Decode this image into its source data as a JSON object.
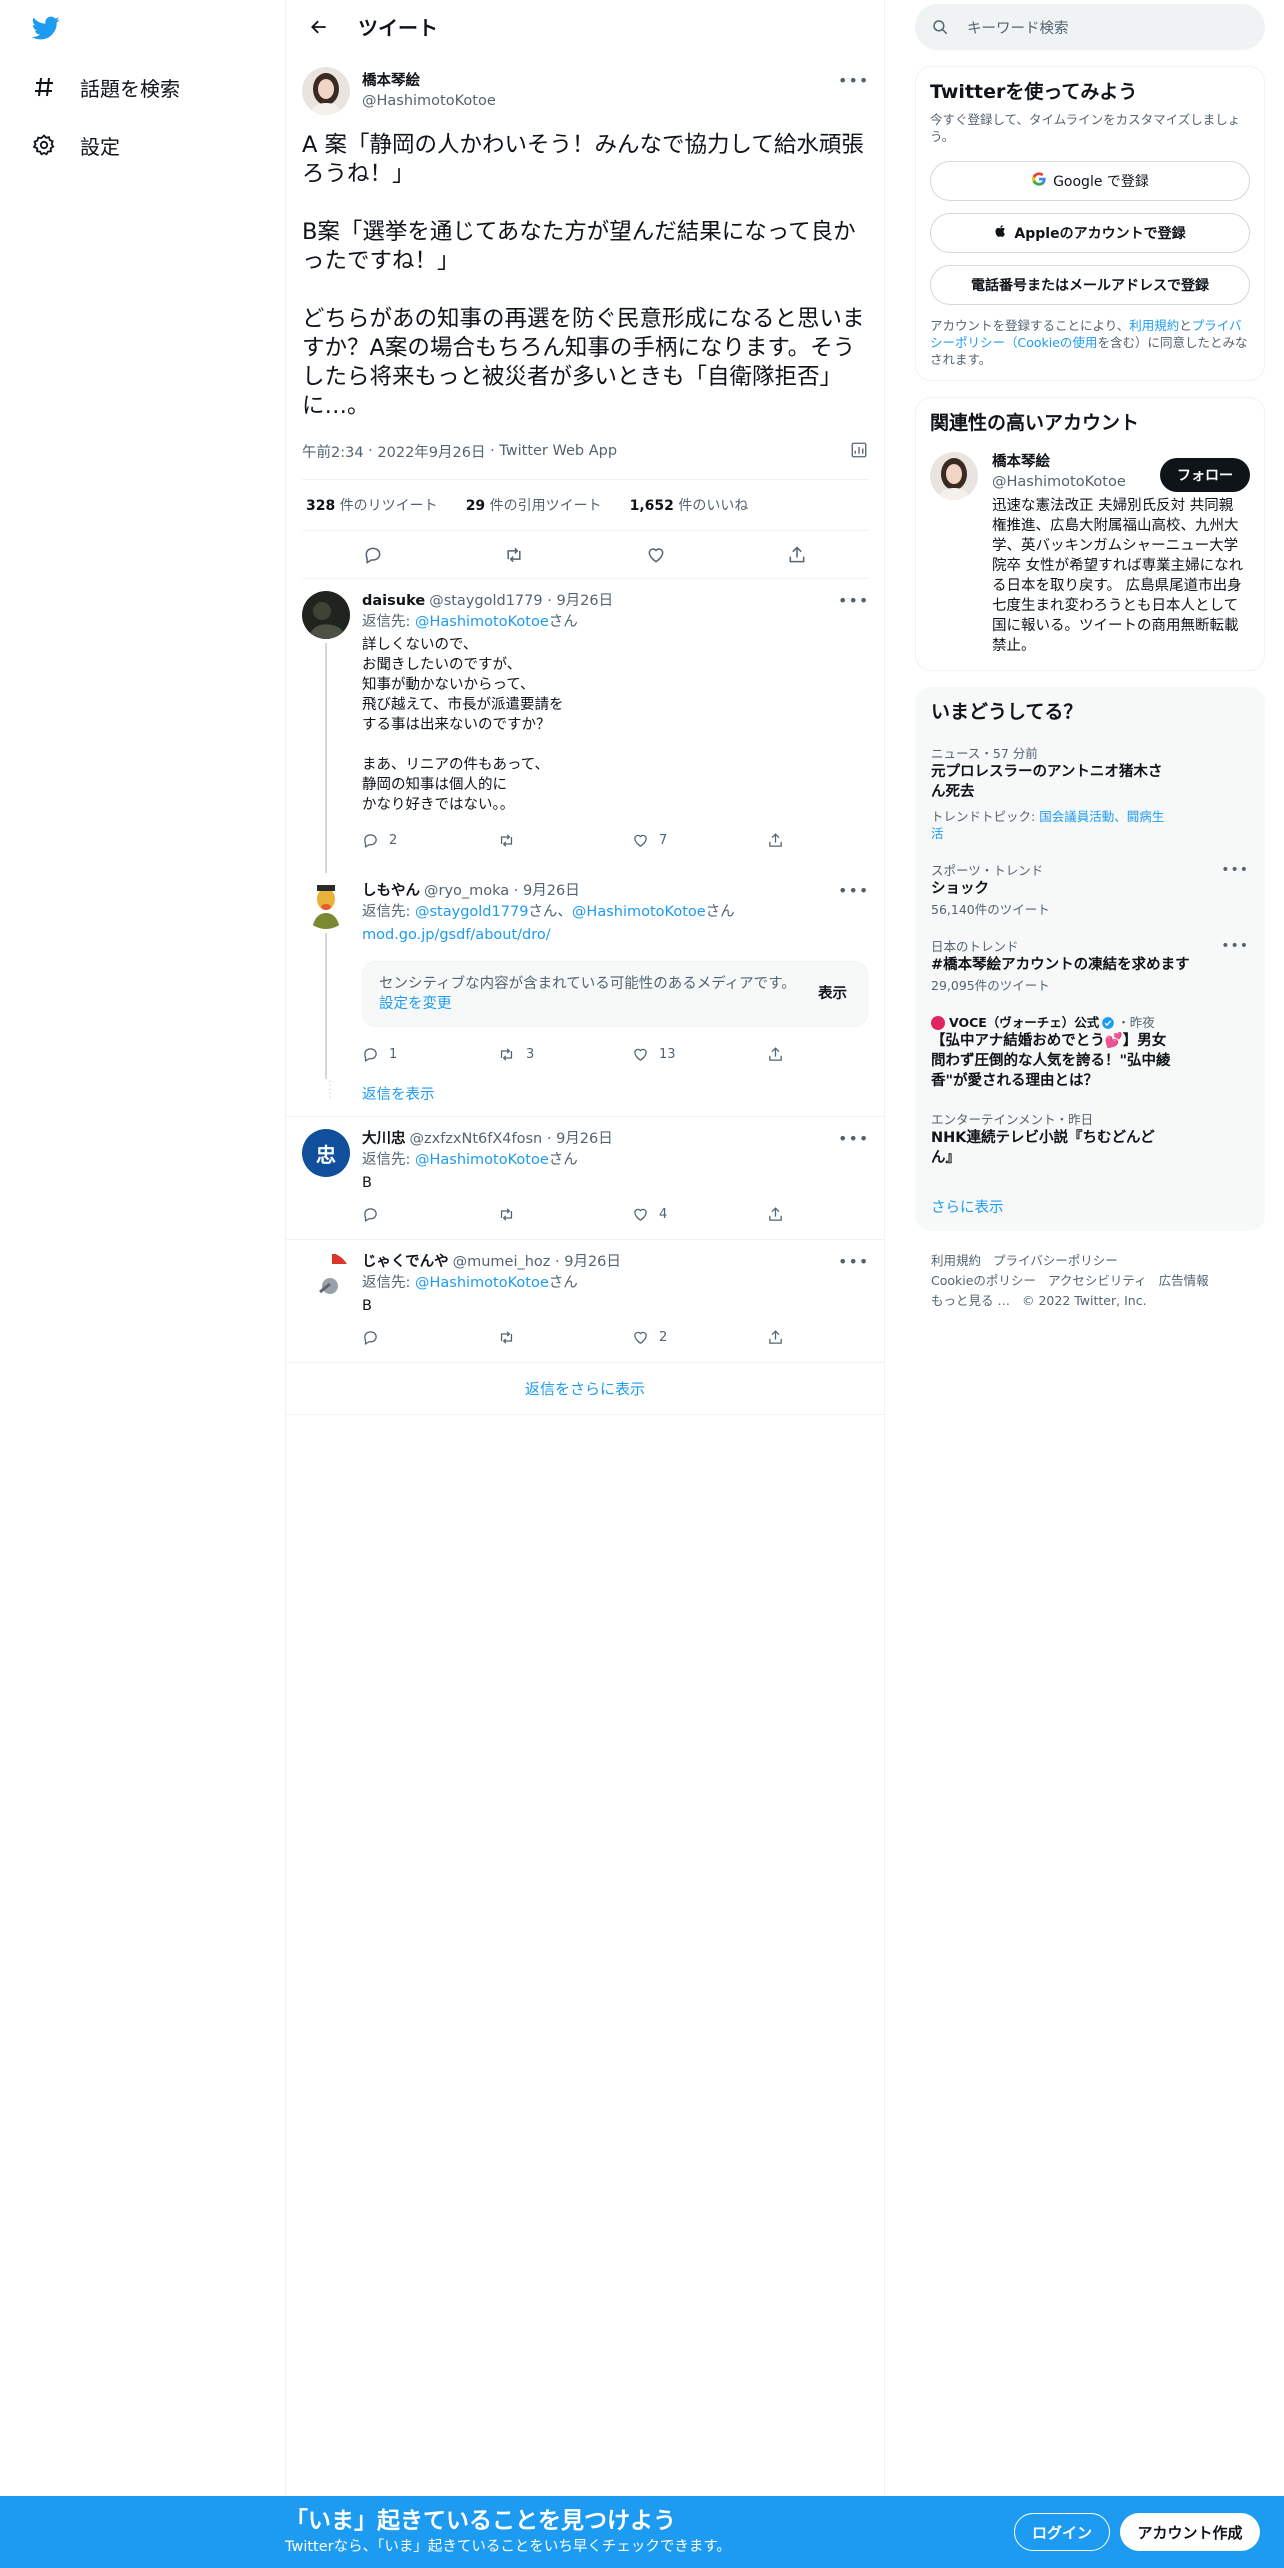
{
  "nav": {
    "explore_label": "話題を検索",
    "settings_label": "設定"
  },
  "header": {
    "title": "ツイート"
  },
  "focal": {
    "name": "橋本琴絵",
    "handle": "@HashimotoKotoe",
    "text": "A 案「静岡の人かわいそう！みんなで協力して給水頑張ろうね！」\n\nB案「選挙を通じてあなた方が望んだ結果になって良かったですね！」\n\nどちらがあの知事の再選を防ぐ民意形成になると思いますか？A案の場合もちろん知事の手柄になります。そうしたら将来もっと被災者が多いときも「自衛隊拒否」に…。",
    "time": "午前2:34",
    "date": "2022年9月26日",
    "source": "Twitter Web App",
    "retweets": "328",
    "retweets_label": "件のリツイート",
    "quotes": "29",
    "quotes_label": "件の引用ツイート",
    "likes": "1,652",
    "likes_label": "件のいいね"
  },
  "replies": [
    {
      "name": "daisuke",
      "handle": "@staygold1779",
      "date": "9月26日",
      "reply_to_prefix": "返信先: ",
      "reply_to": "@HashimotoKotoe",
      "reply_to_suffix": "さん",
      "text": "詳しくないので、\nお聞きしたいのですが、\n知事が動かないからって、\n飛び越えて、市長が派遣要請を\nする事は出来ないのですか？\n\nまあ、リニアの件もあって、\n静岡の知事は個人的に\nかなり好きではない。。",
      "replies": "2",
      "retweets": "",
      "likes": "7"
    },
    {
      "name": "しもやん",
      "handle": "@ryo_moka",
      "date": "9月26日",
      "reply_to_prefix": "返信先: ",
      "reply_to": "@staygold1779",
      "reply_to_mid": "さん、",
      "reply_to2": "@HashimotoKotoe",
      "reply_to_suffix": "さん",
      "link": "mod.go.jp/gsdf/about/dro/",
      "sensitive_text": "センシティブな内容が含まれている可能性のあるメディアです。",
      "sensitive_link": "設定を変更",
      "sensitive_show": "表示",
      "replies": "1",
      "retweets": "3",
      "likes": "13"
    },
    {
      "name": "大川忠",
      "handle": "@zxfzxNt6fX4fosn",
      "date": "9月26日",
      "reply_to_prefix": "返信先: ",
      "reply_to": "@HashimotoKotoe",
      "reply_to_suffix": "さん",
      "text": "B",
      "replies": "",
      "retweets": "",
      "likes": "4",
      "avatar_char": "忠"
    },
    {
      "name": "じゃくでんや",
      "handle": "@mumei_hoz",
      "date": "9月26日",
      "reply_to_prefix": "返信先: ",
      "reply_to": "@HashimotoKotoe",
      "reply_to_suffix": "さん",
      "text": "B",
      "replies": "",
      "retweets": "",
      "likes": "2"
    }
  ],
  "show_replies_label": "返信を表示",
  "more_replies_label": "返信をさらに表示",
  "search": {
    "placeholder": "キーワード検索"
  },
  "signup_card": {
    "title": "Twitterを使ってみよう",
    "subtitle": "今すぐ登録して、タイムラインをカスタマイズしましょう。",
    "google_label": "Google で登録",
    "apple_label": "Appleのアカウントで登録",
    "phone_label": "電話番号またはメールアドレスで登録",
    "legal_1": "アカウントを登録することにより、",
    "legal_terms": "利用規約",
    "legal_2": "と",
    "legal_privacy": "プライバシーポリシー（Cookieの使用",
    "legal_3": "を含む）に同意したとみなされます。"
  },
  "related": {
    "title": "関連性の高いアカウント",
    "name": "橋本琴絵",
    "handle": "@HashimotoKotoe",
    "follow_label": "フォロー",
    "bio": "迅速な憲法改正 夫婦別氏反対 共同親権推進、広島大附属福山高校、九州大学、英バッキンガムシャーニュー大学院卒 女性が希望すれば専業主婦になれる日本を取り戻す。 広島県尾道市出身 七度生まれ変わろうとも日本人として国に報いる。ツイートの商用無断転載禁止。"
  },
  "trends": {
    "title": "いまどうしてる？",
    "items": [
      {
        "context": "ニュース・57 分前",
        "title": "元プロレスラーのアントニオ猪木さん死去",
        "topics_prefix": "トレンドトピック: ",
        "topics": "国会議員活動、闘病生活"
      },
      {
        "context": "スポーツ・トレンド",
        "title": "ショック",
        "count": "56,140件のツイート"
      },
      {
        "context": "日本のトレンド",
        "title": "#橋本琴絵アカウントの凍結を求めます",
        "count": "29,095件のツイート"
      },
      {
        "context_name": "VOCE（ヴォーチェ）公式",
        "context_time": "・昨夜",
        "title": "【弘中アナ結婚おめでとう💕】男女問わず圧倒的な人気を誇る！\"弘中綾香\"が愛される理由とは？"
      },
      {
        "context": "エンターテインメント・昨日",
        "title": "NHK連続テレビ小説『ちむどんどん』"
      }
    ],
    "show_more": "さらに表示"
  },
  "footer": {
    "links": [
      "利用規約",
      "プライバシーポリシー",
      "Cookieのポリシー",
      "アクセシビリティ",
      "広告情報",
      "もっと見る …"
    ],
    "copyright": "© 2022 Twitter, Inc."
  },
  "bottom_bar": {
    "title": "「いま」起きていることを見つけよう",
    "subtitle": "Twitterなら、「いま」起きていることをいち早くチェックできます。",
    "login_label": "ログイン",
    "signup_label": "アカウント作成"
  },
  "colors": {
    "accent": "#1d9bf0",
    "text": "#0f1419",
    "secondary": "#536471"
  }
}
